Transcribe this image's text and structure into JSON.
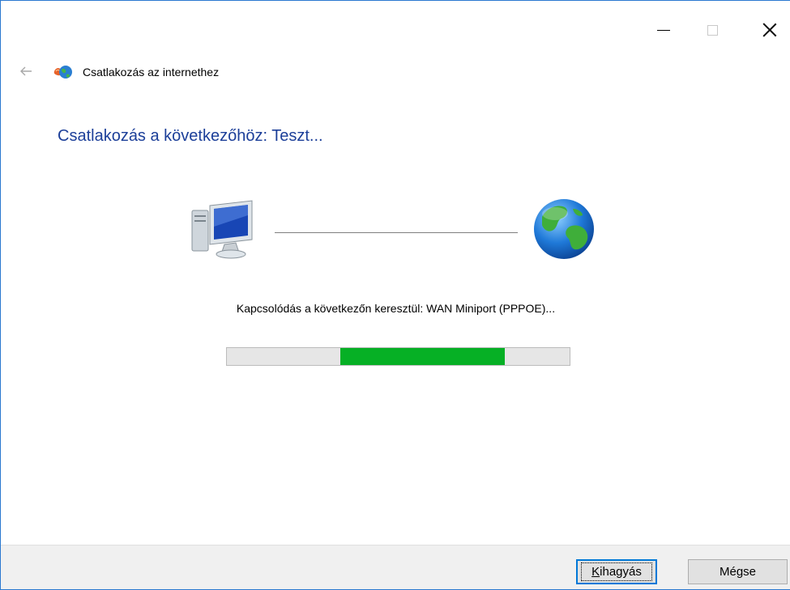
{
  "window": {
    "title": "Csatlakozás az internethez",
    "accent_color": "#2b79d0"
  },
  "caption_buttons": {
    "minimize_icon": "minimize-icon",
    "maximize_icon": "maximize-icon",
    "close_icon": "close-icon"
  },
  "nav": {
    "back_icon": "back-arrow-icon"
  },
  "main": {
    "heading": "Csatlakozás a következőhöz: Teszt...",
    "heading_color": "#1c3f99",
    "status": "Kapcsolódás a következőn keresztül: WAN Miniport (PPPOE)...",
    "progress": {
      "mode": "marquee",
      "fill_color": "#06b025"
    },
    "left_icon": "computer-icon",
    "right_icon": "globe-icon"
  },
  "footer": {
    "skip_label_accel": "K",
    "skip_label_rest": "ihagyás",
    "cancel_label": "Mégse"
  }
}
